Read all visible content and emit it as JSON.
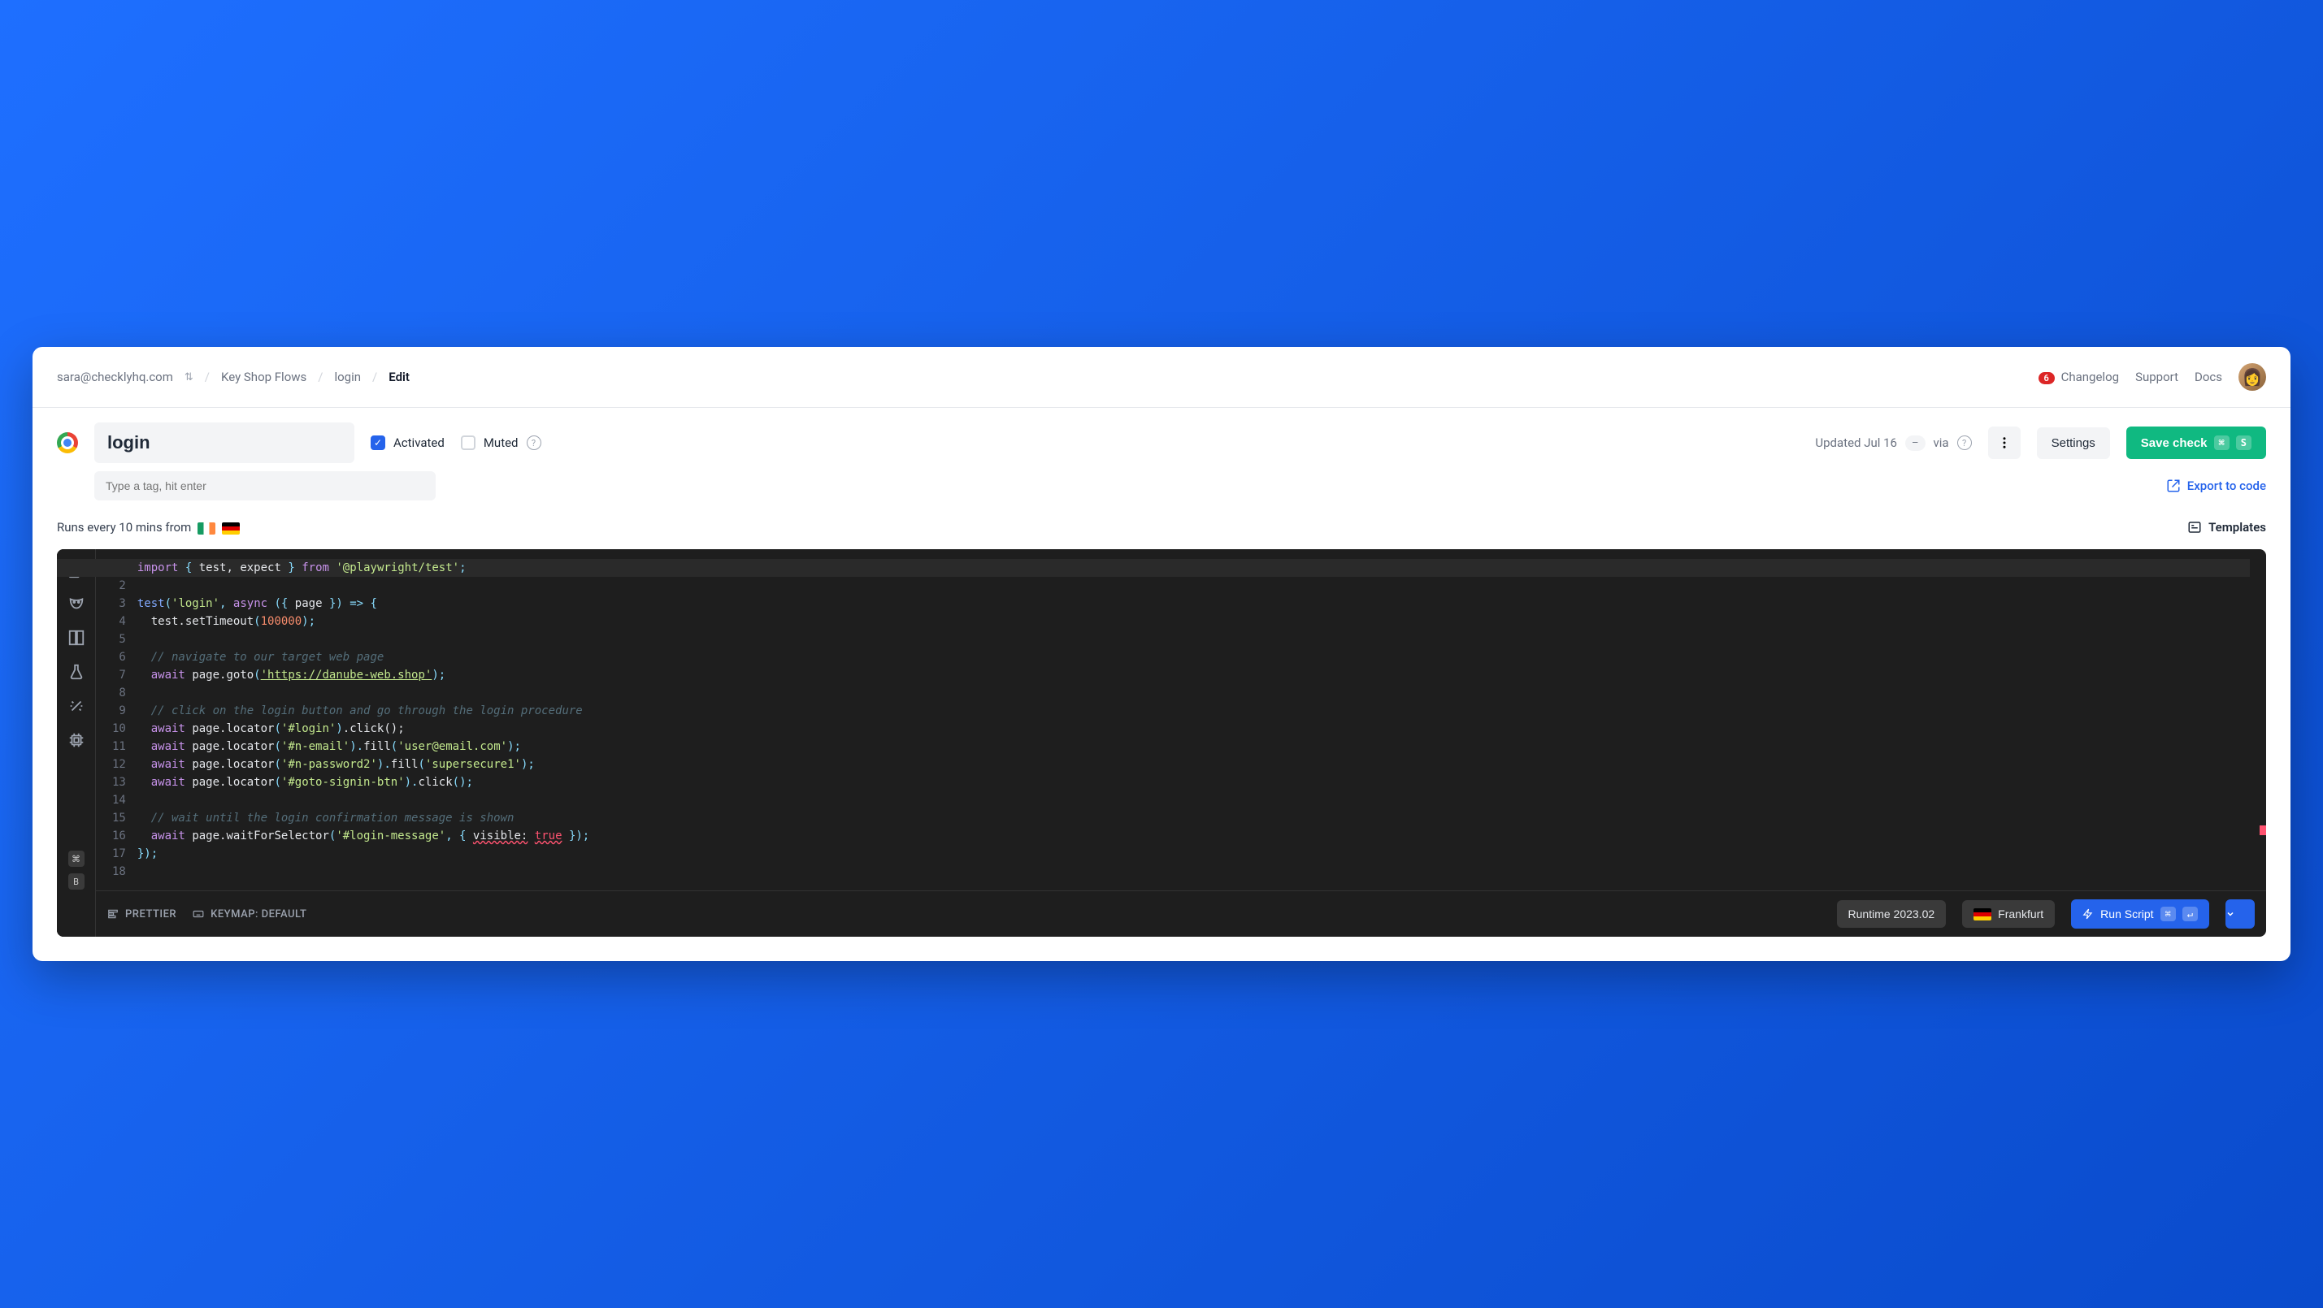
{
  "breadcrumb": {
    "email": "sara@checklyhq.com",
    "group": "Key Shop Flows",
    "check": "login",
    "page": "Edit"
  },
  "topnav": {
    "changelog_count": "6",
    "changelog": "Changelog",
    "support": "Support",
    "docs": "Docs"
  },
  "header": {
    "name": "login",
    "activated_label": "Activated",
    "muted_label": "Muted",
    "updated": "Updated Jul 16",
    "via": "via",
    "dash": "–",
    "settings": "Settings",
    "save": "Save check",
    "save_k1": "⌘",
    "save_k2": "S"
  },
  "tags": {
    "placeholder": "Type a tag, hit enter"
  },
  "export_label": "Export to code",
  "schedule_text": "Runs every 10 mins from",
  "templates_label": "Templates",
  "code": {
    "l1_import": "import",
    "l1_ids": "test, expect",
    "l1_from": "from",
    "l1_pkg": "'@playwright/test'",
    "l3_testcall": "test",
    "l3_name": "'login'",
    "l3_async": "async",
    "l3_arg": "page",
    "l4_call": "test.setTimeout",
    "l4_num": "100000",
    "l6": "// navigate to our target web page",
    "l7_await": "await",
    "l7_call": "page.goto",
    "l7_url": "'https://danube-web.shop'",
    "l9": "// click on the login button and go through the login procedure",
    "l10_sel": "'#login'",
    "l10_click": ".click();",
    "l11_sel": "'#n-email'",
    "l11_val": "'user@email.com'",
    "l12_sel": "'#n-password2'",
    "l12_val": "'supersecure1'",
    "l13_sel": "'#goto-signin-btn'",
    "l15": "// wait until the login confirmation message is shown",
    "l16_call": "page.waitForSelector",
    "l16_sel": "'#login-message'",
    "l16_vis": "visible:",
    "l16_true": "true"
  },
  "footer": {
    "prettier": "Prettier",
    "keymap": "Keymap: Default",
    "runtime": "Runtime 2023.02",
    "location": "Frankfurt",
    "run": "Run Script",
    "run_k1": "⌘",
    "run_k2": "↵"
  }
}
